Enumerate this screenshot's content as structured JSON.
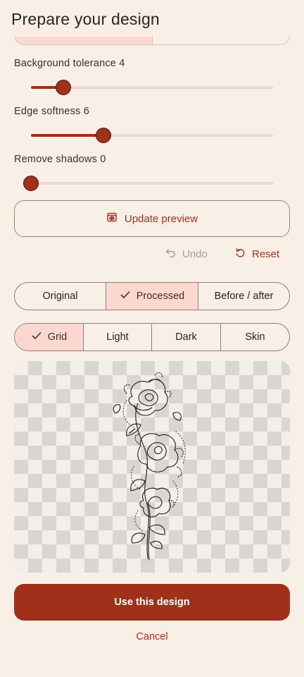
{
  "header": {
    "title": "Prepare your design"
  },
  "sliders": [
    {
      "label": "Background tolerance 4",
      "value": 4,
      "min": 0,
      "max": 30
    },
    {
      "label": "Edge softness 6",
      "value": 6,
      "min": 0,
      "max": 20
    },
    {
      "label": "Remove shadows 0",
      "value": 0,
      "min": 0,
      "max": 20
    }
  ],
  "actions": {
    "update_preview": "Update preview",
    "undo": "Undo",
    "reset": "Reset"
  },
  "view_modes": {
    "selected": "Processed",
    "items": [
      "Original",
      "Processed",
      "Before / after"
    ]
  },
  "backgrounds": {
    "selected": "Grid",
    "items": [
      "Grid",
      "Light",
      "Dark",
      "Skin"
    ]
  },
  "footer": {
    "use_label": "Use this design",
    "cancel_label": "Cancel"
  },
  "colors": {
    "accent": "#a0311a",
    "accent_soft": "#fad8d0",
    "background": "#f8efe6"
  },
  "icons": [
    "eye-frame-icon",
    "undo-icon",
    "reset-icon",
    "check-icon"
  ]
}
